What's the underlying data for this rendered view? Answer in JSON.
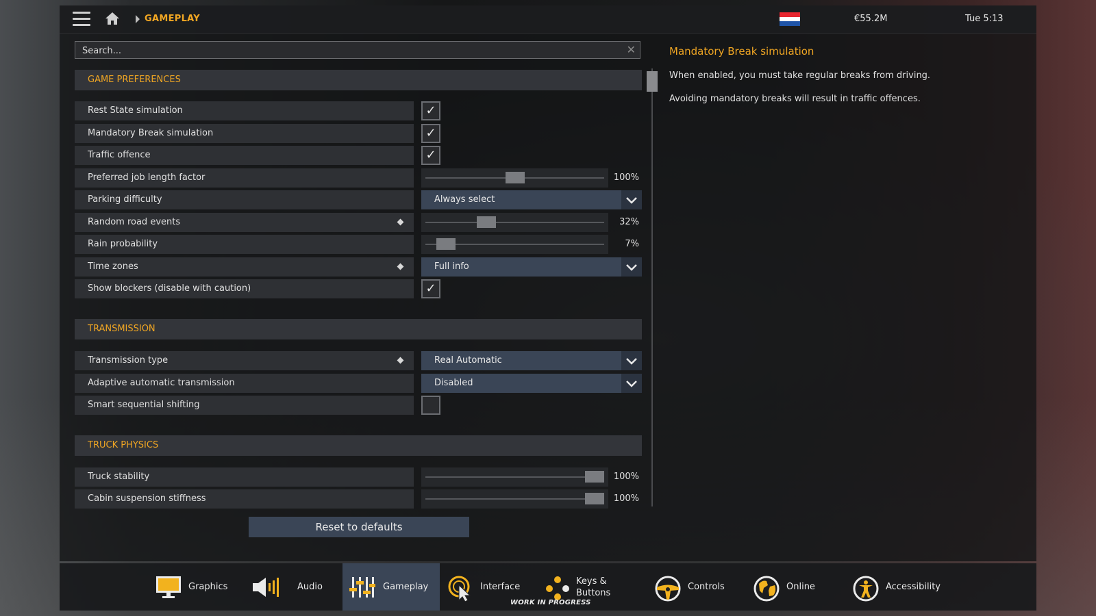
{
  "topbar": {
    "breadcrumb": "GAMEPLAY",
    "money": "€55.2M",
    "time": "Tue 5:13",
    "flag_colors": [
      "#e8262f",
      "#ffffff",
      "#1f54a8"
    ],
    "icons": [
      "hamburger-menu-icon",
      "home-icon",
      "chevron-right-icon",
      "flag-icon"
    ]
  },
  "search": {
    "placeholder": "Search..."
  },
  "sections": {
    "game_preferences": {
      "title": "GAME PREFERENCES",
      "rows": {
        "rest_state": {
          "label": "Rest State simulation",
          "checked": true
        },
        "mandatory_break": {
          "label": "Mandatory Break simulation",
          "checked": true
        },
        "traffic_offence": {
          "label": "Traffic offence",
          "checked": true
        },
        "job_length": {
          "label": "Preferred job length factor",
          "value": "100%",
          "level": 0.5
        },
        "parking": {
          "label": "Parking difficulty",
          "value": "Always select"
        },
        "random_events": {
          "label": "Random road events",
          "value": "32%",
          "level": 0.32
        },
        "rain": {
          "label": "Rain probability",
          "value": "7%",
          "level": 0.07
        },
        "time_zones": {
          "label": "Time zones",
          "value": "Full info"
        },
        "blockers": {
          "label": "Show blockers (disable with caution)",
          "checked": true
        }
      }
    },
    "transmission": {
      "title": "TRANSMISSION",
      "rows": {
        "type": {
          "label": "Transmission type",
          "value": "Real Automatic"
        },
        "adaptive": {
          "label": "Adaptive automatic transmission",
          "value": "Disabled"
        },
        "smart": {
          "label": "Smart sequential shifting",
          "checked": false
        }
      }
    },
    "truck_physics": {
      "title": "TRUCK PHYSICS",
      "rows": {
        "stability": {
          "label": "Truck stability",
          "value": "100%",
          "level": 1.0
        },
        "cabin": {
          "label": "Cabin suspension stiffness",
          "value": "100%",
          "level": 1.0
        }
      }
    }
  },
  "info": {
    "title": "Mandatory Break simulation",
    "line1": "When enabled, you must take regular breaks from driving.",
    "line2": "Avoiding mandatory breaks will result in traffic offences."
  },
  "reset_label": "Reset to defaults",
  "bottom_tabs": {
    "graphics": "Graphics",
    "audio": "Audio",
    "gameplay": "Gameplay",
    "interface": "Interface",
    "keys_line1": "Keys &",
    "keys_line2": "Buttons",
    "controls": "Controls",
    "online": "Online",
    "accessibility": "Accessibility",
    "wip": "WORK IN PROGRESS",
    "active": "gameplay",
    "accent_color": "#f0a623",
    "icon_color": "#f2b21e"
  }
}
